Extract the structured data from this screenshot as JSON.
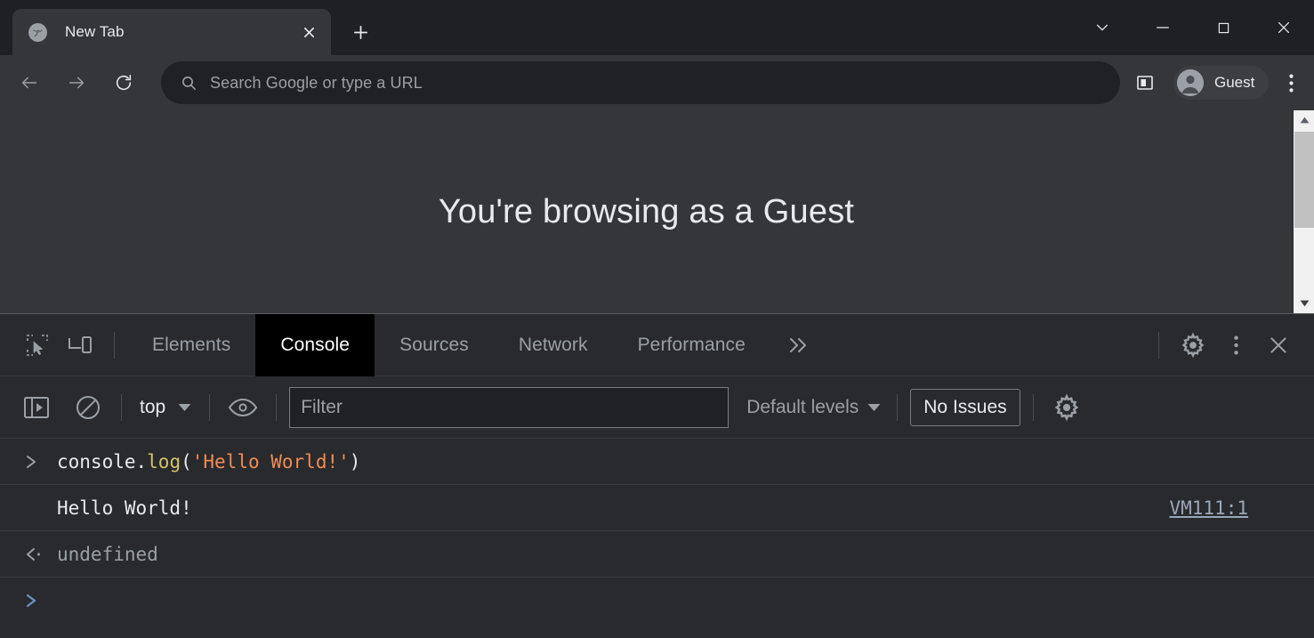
{
  "browser": {
    "tab": {
      "title": "New Tab",
      "favicon_icon": "globe-icon",
      "close_icon": "close-icon"
    },
    "new_tab_icon": "plus-icon",
    "window_controls": [
      {
        "name": "tab-search",
        "icon": "chevron-down-icon"
      },
      {
        "name": "minimize",
        "icon": "minimize-icon"
      },
      {
        "name": "maximize",
        "icon": "maximize-icon"
      },
      {
        "name": "close",
        "icon": "close-icon"
      }
    ],
    "toolbar": {
      "back_icon": "arrow-left-icon",
      "forward_icon": "arrow-right-icon",
      "reload_icon": "reload-icon",
      "omnibox": {
        "search_icon": "search-icon",
        "value": "",
        "placeholder": "Search Google or type a URL"
      },
      "side_panel_icon": "side-panel-icon",
      "profile": {
        "name": "Guest",
        "avatar_icon": "person-icon"
      },
      "menu_icon": "kebab-menu-icon"
    }
  },
  "page": {
    "heading": "You're browsing as a Guest",
    "scrollbar": {
      "up_icon": "triangle-up-icon",
      "down_icon": "triangle-down-icon"
    }
  },
  "devtools": {
    "left_tools": [
      {
        "name": "inspect-element",
        "icon": "inspect-cursor-icon"
      },
      {
        "name": "device-toolbar",
        "icon": "device-toggle-icon"
      }
    ],
    "tabs": [
      {
        "label": "Elements",
        "active": false
      },
      {
        "label": "Console",
        "active": true
      },
      {
        "label": "Sources",
        "active": false
      },
      {
        "label": "Network",
        "active": false
      },
      {
        "label": "Performance",
        "active": false
      }
    ],
    "more_tabs_icon": "chevron-double-right-icon",
    "right_tools": [
      {
        "name": "settings",
        "icon": "gear-icon"
      },
      {
        "name": "more-options",
        "icon": "kebab-menu-icon"
      },
      {
        "name": "close-devtools",
        "icon": "close-icon"
      }
    ],
    "console_toolbar": {
      "sidebar_icon": "console-sidebar-icon",
      "clear_icon": "clear-console-icon",
      "context": {
        "label": "top",
        "caret_icon": "caret-down-icon"
      },
      "eye_icon": "live-expression-eye-icon",
      "filter": {
        "value": "",
        "placeholder": "Filter"
      },
      "levels": {
        "label": "Default levels",
        "caret_icon": "caret-down-icon"
      },
      "issues_label": "No Issues",
      "settings_icon": "gear-icon"
    },
    "messages": [
      {
        "kind": "input",
        "gutter_icon": "chevron-right-icon",
        "tokens": [
          {
            "t": "console.",
            "c": "plain"
          },
          {
            "t": "log",
            "c": "fn"
          },
          {
            "t": "(",
            "c": "punct"
          },
          {
            "t": "'Hello World!'",
            "c": "str"
          },
          {
            "t": ")",
            "c": "punct"
          }
        ],
        "source": ""
      },
      {
        "kind": "output",
        "gutter_icon": "",
        "text": "Hello World!",
        "source": "VM111:1"
      },
      {
        "kind": "result",
        "gutter_icon": "return-arrow-icon",
        "text": "undefined",
        "source": ""
      }
    ],
    "prompt": {
      "gutter_icon": "chevron-right-icon",
      "value": ""
    }
  },
  "colors": {
    "tabstrip_bg": "#1f2023",
    "toolbar_bg": "#35363a",
    "omnibox_bg": "#202124",
    "devtools_bg": "#282a2d",
    "active_tab_bg": "#000000",
    "text_primary": "#e8eaed",
    "text_secondary": "#9aa0a6",
    "string_token": "#f28b54",
    "function_token": "#d3c36b",
    "link": "#9aa7b8",
    "prompt_chevron": "#6e93c9"
  }
}
